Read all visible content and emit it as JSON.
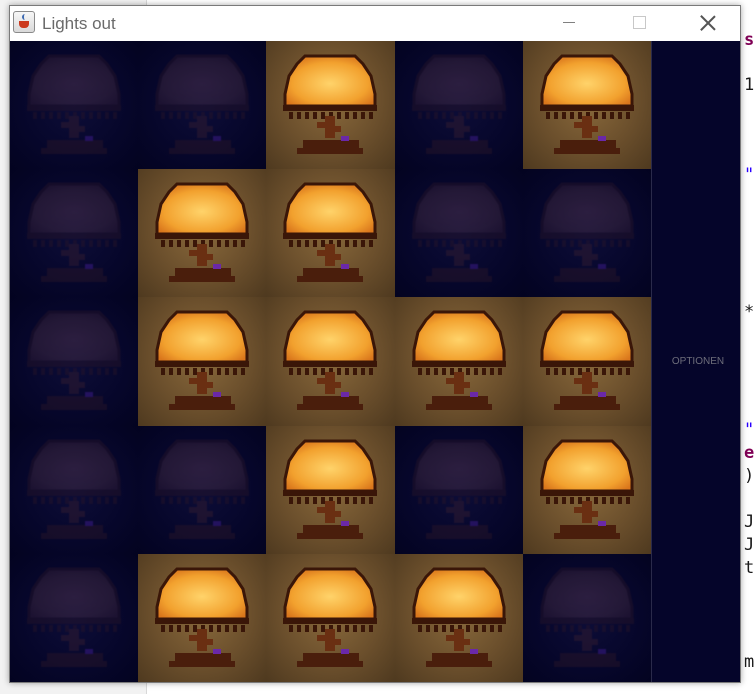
{
  "window": {
    "title": "Lights out",
    "app_icon": "java-cup-icon",
    "controls": {
      "minimize": "minimize-icon",
      "maximize": "maximize-icon",
      "close": "close-icon"
    }
  },
  "board": {
    "rows": 5,
    "cols": 5,
    "lamp_icon": "table-lamp-icon",
    "states": [
      [
        false,
        false,
        true,
        false,
        true
      ],
      [
        false,
        true,
        true,
        false,
        false
      ],
      [
        false,
        true,
        true,
        true,
        true
      ],
      [
        false,
        false,
        true,
        false,
        true
      ],
      [
        false,
        true,
        true,
        true,
        false
      ]
    ]
  },
  "side_panel": {
    "options_label": "OPTIONEN"
  },
  "background_editor": {
    "visible_chars": [
      "s",
      "1",
      "\"",
      "*",
      "\"",
      "e",
      ")",
      "J",
      "J",
      "t",
      "m"
    ]
  },
  "colors": {
    "board_background": "#05052a",
    "lamp_shade_lit": "#f2a12e",
    "lamp_shade_unlit": "#4a3044",
    "tile_lit": "#6b4f2c"
  }
}
